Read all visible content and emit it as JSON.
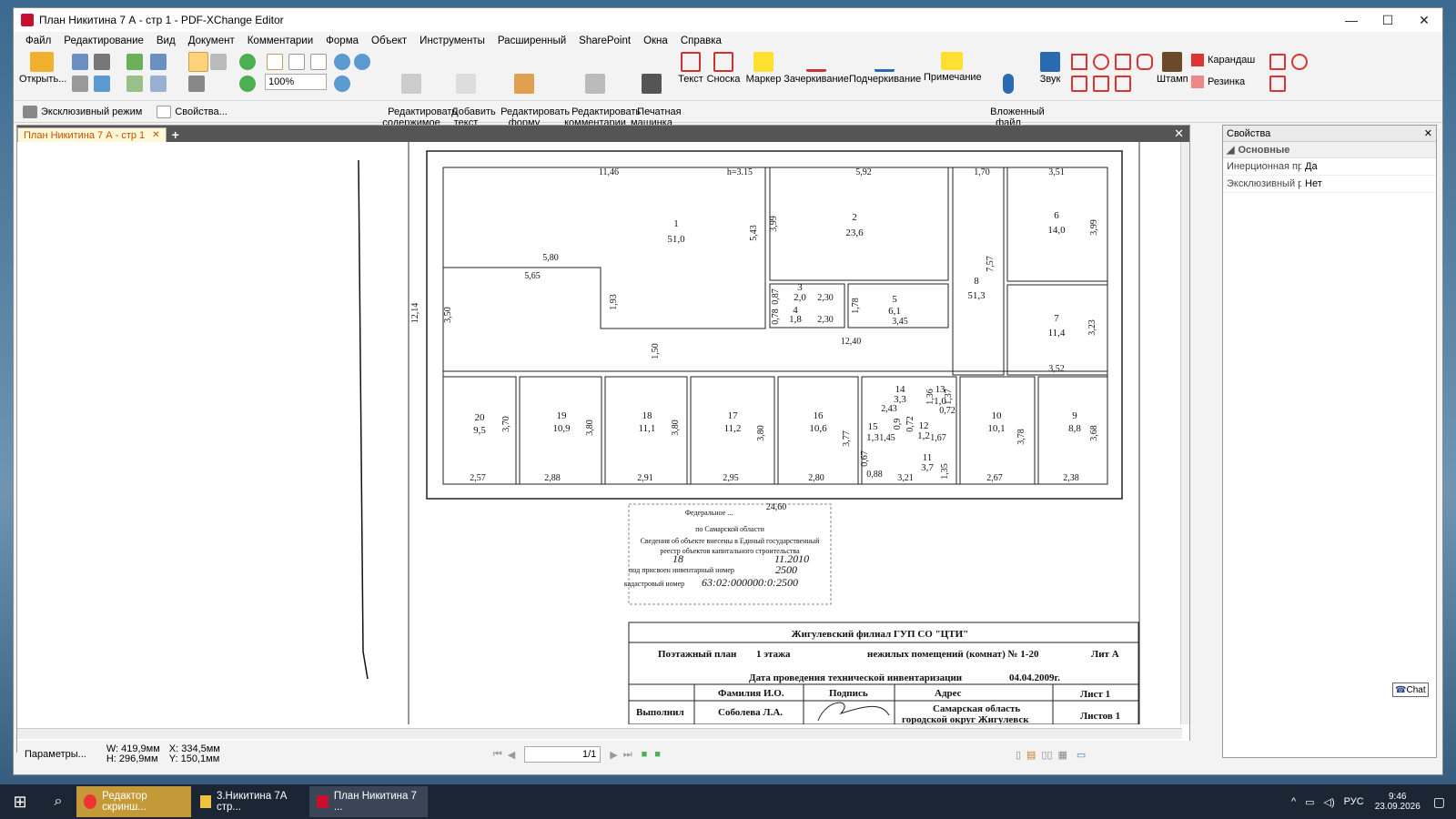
{
  "window": {
    "title": "План Никитина 7 А - стр 1 - PDF-XChange Editor"
  },
  "menu": [
    "Файл",
    "Редактирование",
    "Вид",
    "Документ",
    "Комментарии",
    "Форма",
    "Объект",
    "Инструменты",
    "Расширенный",
    "SharePoint",
    "Окна",
    "Справка"
  ],
  "toolbar": {
    "open": "Открыть...",
    "zoom": "100%",
    "edit_content": "Редактировать\nсодержимое",
    "add_text": "Добавить\nтекст",
    "edit_form": "Редактировать\nформу",
    "edit_comments": "Редактировать\nкомментарии",
    "typewriter": "Печатная\nмашинка",
    "text": "Текст",
    "callout": "Сноска",
    "marker": "Маркер",
    "strikeout": "Зачеркивание",
    "underline": "Подчеркивание",
    "note": "Примечание",
    "attached": "Вложенный\nфайл",
    "sound": "Звук",
    "stamp": "Штамп",
    "pencil": "Карандаш",
    "eraser": "Резинка"
  },
  "toolbar2": {
    "exclusive": "Эксклюзивный режим",
    "properties": "Свойства..."
  },
  "tab": {
    "label": "План Никитина 7 А - стр 1"
  },
  "props": {
    "title": "Свойства",
    "group": "Основные",
    "rows": [
      {
        "k": "Инерционная пр...",
        "v": "Да"
      },
      {
        "k": "Эксклюзивный р...",
        "v": "Нет"
      }
    ]
  },
  "status": {
    "params": "Параметры...",
    "w": "W: 419,9мм",
    "h": "H: 296,9мм",
    "x": "X: 334,5мм",
    "y": "Y: 150,1мм",
    "page": "1/1"
  },
  "plan": {
    "rooms": [
      {
        "n": "1",
        "a": "51,0"
      },
      {
        "n": "2",
        "a": "23,6"
      },
      {
        "n": "3",
        "a": "2,0"
      },
      {
        "n": "4",
        "a": "1,8"
      },
      {
        "n": "5",
        "a": "6,1"
      },
      {
        "n": "6",
        "a": "14,0"
      },
      {
        "n": "7",
        "a": "11,4"
      },
      {
        "n": "8",
        "a": "51,3"
      },
      {
        "n": "9",
        "a": "8,8"
      },
      {
        "n": "10",
        "a": "10,1"
      },
      {
        "n": "11",
        "a": "3,7"
      },
      {
        "n": "12",
        "a": "1,2"
      },
      {
        "n": "13",
        "a": "1,0"
      },
      {
        "n": "14",
        "a": "3,3"
      },
      {
        "n": "15",
        "a": "1,3"
      },
      {
        "n": "16",
        "a": "10,6"
      },
      {
        "n": "17",
        "a": "11,2"
      },
      {
        "n": "18",
        "a": "11,1"
      },
      {
        "n": "19",
        "a": "10,9"
      },
      {
        "n": "20",
        "a": "9,5"
      }
    ],
    "dims": [
      "11,46",
      "h=3.15",
      "5,92",
      "1,70",
      "3,51",
      "5,80",
      "5,65",
      "5,43",
      "3,99",
      "3,99",
      "12,14",
      "3,50",
      "1,93",
      "0,87",
      "2,30",
      "0,78",
      "2,30",
      "1,78",
      "3,45",
      "7,57",
      "12,40",
      "3,23",
      "3,52",
      "1,50",
      "3,70",
      "3,80",
      "3,80",
      "3,80",
      "3,77",
      "2,43",
      "1,36",
      "1,37",
      "0,72",
      "3,78",
      "3,68",
      "0,9",
      "0,72",
      "1,45",
      "1,67",
      "0,67",
      "0,88",
      "3,21",
      "1,35",
      "2,57",
      "2,88",
      "2,91",
      "2,95",
      "2,80",
      "2,67",
      "2,38",
      "24,60"
    ],
    "stamp": [
      "Федеральное ...",
      "по Самарской области",
      "Сведения об объекте внесены в Единый государственный",
      "реестр объектов капитального строительства",
      "18",
      "11.2010",
      "под присвоен инвентарный номер",
      "2500",
      "кадастровый номер",
      "63:02:000000:0:2500"
    ],
    "titleblock": {
      "org": "Жигулевский   филиал   ГУП   СО   \"ЦТИ\"",
      "plan": "Поэтажный   план",
      "floor": "1      этажа",
      "rooms": "нежилых   помещений (комнат)   №  1-20",
      "lit": "Лит А",
      "date_label": "Дата проведения технической инвентаризации",
      "date": "04.04.2009г.",
      "h_name": "Фамилия И.О.",
      "h_sign": "Подпись",
      "h_addr": "Адрес",
      "h_sheet": "Лист     1",
      "h_sheets": "Листов     1",
      "done": "Выполнил",
      "name": "Соболева Л.А.",
      "addr1": "Самарская область",
      "addr2": "городской округ Жигулевск"
    }
  },
  "taskbar": {
    "items": [
      "Редактор скринш...",
      "3.Никитина 7А стр...",
      "План Никитина 7 ..."
    ],
    "lang": "РУС",
    "time": "9:46",
    "date": "23.09.2026"
  },
  "chat_badge": "Chat"
}
